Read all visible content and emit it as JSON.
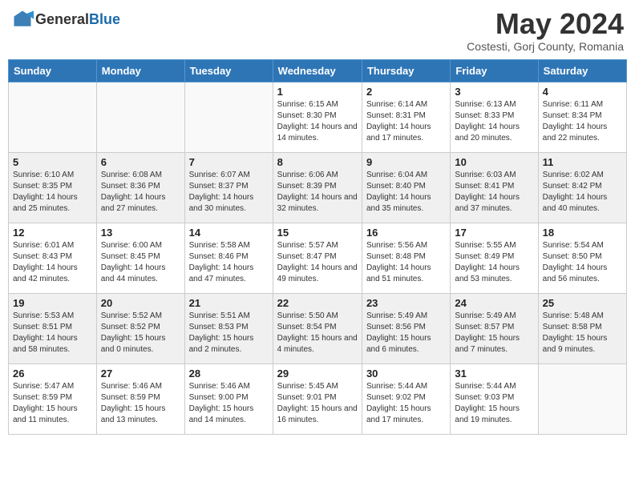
{
  "header": {
    "logo_general": "General",
    "logo_blue": "Blue",
    "month_title": "May 2024",
    "subtitle": "Costesti, Gorj County, Romania"
  },
  "columns": [
    "Sunday",
    "Monday",
    "Tuesday",
    "Wednesday",
    "Thursday",
    "Friday",
    "Saturday"
  ],
  "weeks": [
    [
      {
        "day": "",
        "info": ""
      },
      {
        "day": "",
        "info": ""
      },
      {
        "day": "",
        "info": ""
      },
      {
        "day": "1",
        "info": "Sunrise: 6:15 AM\nSunset: 8:30 PM\nDaylight: 14 hours and 14 minutes."
      },
      {
        "day": "2",
        "info": "Sunrise: 6:14 AM\nSunset: 8:31 PM\nDaylight: 14 hours and 17 minutes."
      },
      {
        "day": "3",
        "info": "Sunrise: 6:13 AM\nSunset: 8:33 PM\nDaylight: 14 hours and 20 minutes."
      },
      {
        "day": "4",
        "info": "Sunrise: 6:11 AM\nSunset: 8:34 PM\nDaylight: 14 hours and 22 minutes."
      }
    ],
    [
      {
        "day": "5",
        "info": "Sunrise: 6:10 AM\nSunset: 8:35 PM\nDaylight: 14 hours and 25 minutes."
      },
      {
        "day": "6",
        "info": "Sunrise: 6:08 AM\nSunset: 8:36 PM\nDaylight: 14 hours and 27 minutes."
      },
      {
        "day": "7",
        "info": "Sunrise: 6:07 AM\nSunset: 8:37 PM\nDaylight: 14 hours and 30 minutes."
      },
      {
        "day": "8",
        "info": "Sunrise: 6:06 AM\nSunset: 8:39 PM\nDaylight: 14 hours and 32 minutes."
      },
      {
        "day": "9",
        "info": "Sunrise: 6:04 AM\nSunset: 8:40 PM\nDaylight: 14 hours and 35 minutes."
      },
      {
        "day": "10",
        "info": "Sunrise: 6:03 AM\nSunset: 8:41 PM\nDaylight: 14 hours and 37 minutes."
      },
      {
        "day": "11",
        "info": "Sunrise: 6:02 AM\nSunset: 8:42 PM\nDaylight: 14 hours and 40 minutes."
      }
    ],
    [
      {
        "day": "12",
        "info": "Sunrise: 6:01 AM\nSunset: 8:43 PM\nDaylight: 14 hours and 42 minutes."
      },
      {
        "day": "13",
        "info": "Sunrise: 6:00 AM\nSunset: 8:45 PM\nDaylight: 14 hours and 44 minutes."
      },
      {
        "day": "14",
        "info": "Sunrise: 5:58 AM\nSunset: 8:46 PM\nDaylight: 14 hours and 47 minutes."
      },
      {
        "day": "15",
        "info": "Sunrise: 5:57 AM\nSunset: 8:47 PM\nDaylight: 14 hours and 49 minutes."
      },
      {
        "day": "16",
        "info": "Sunrise: 5:56 AM\nSunset: 8:48 PM\nDaylight: 14 hours and 51 minutes."
      },
      {
        "day": "17",
        "info": "Sunrise: 5:55 AM\nSunset: 8:49 PM\nDaylight: 14 hours and 53 minutes."
      },
      {
        "day": "18",
        "info": "Sunrise: 5:54 AM\nSunset: 8:50 PM\nDaylight: 14 hours and 56 minutes."
      }
    ],
    [
      {
        "day": "19",
        "info": "Sunrise: 5:53 AM\nSunset: 8:51 PM\nDaylight: 14 hours and 58 minutes."
      },
      {
        "day": "20",
        "info": "Sunrise: 5:52 AM\nSunset: 8:52 PM\nDaylight: 15 hours and 0 minutes."
      },
      {
        "day": "21",
        "info": "Sunrise: 5:51 AM\nSunset: 8:53 PM\nDaylight: 15 hours and 2 minutes."
      },
      {
        "day": "22",
        "info": "Sunrise: 5:50 AM\nSunset: 8:54 PM\nDaylight: 15 hours and 4 minutes."
      },
      {
        "day": "23",
        "info": "Sunrise: 5:49 AM\nSunset: 8:56 PM\nDaylight: 15 hours and 6 minutes."
      },
      {
        "day": "24",
        "info": "Sunrise: 5:49 AM\nSunset: 8:57 PM\nDaylight: 15 hours and 7 minutes."
      },
      {
        "day": "25",
        "info": "Sunrise: 5:48 AM\nSunset: 8:58 PM\nDaylight: 15 hours and 9 minutes."
      }
    ],
    [
      {
        "day": "26",
        "info": "Sunrise: 5:47 AM\nSunset: 8:59 PM\nDaylight: 15 hours and 11 minutes."
      },
      {
        "day": "27",
        "info": "Sunrise: 5:46 AM\nSunset: 8:59 PM\nDaylight: 15 hours and 13 minutes."
      },
      {
        "day": "28",
        "info": "Sunrise: 5:46 AM\nSunset: 9:00 PM\nDaylight: 15 hours and 14 minutes."
      },
      {
        "day": "29",
        "info": "Sunrise: 5:45 AM\nSunset: 9:01 PM\nDaylight: 15 hours and 16 minutes."
      },
      {
        "day": "30",
        "info": "Sunrise: 5:44 AM\nSunset: 9:02 PM\nDaylight: 15 hours and 17 minutes."
      },
      {
        "day": "31",
        "info": "Sunrise: 5:44 AM\nSunset: 9:03 PM\nDaylight: 15 hours and 19 minutes."
      },
      {
        "day": "",
        "info": ""
      }
    ]
  ]
}
